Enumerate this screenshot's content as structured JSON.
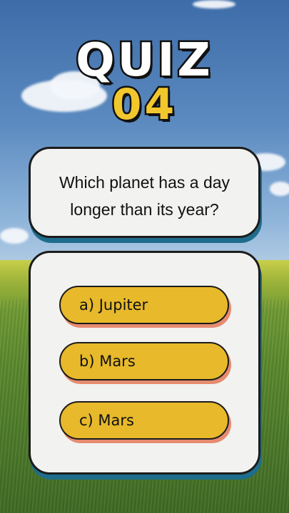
{
  "title": {
    "word": "QUIZ",
    "number": "04"
  },
  "question": {
    "text": "Which planet has a day\nlonger than its year?"
  },
  "answers": [
    {
      "label": "a) Jupiter"
    },
    {
      "label": "b) Mars"
    },
    {
      "label": "c) Mars"
    }
  ],
  "colors": {
    "answer_fill": "#e7b92b",
    "title_number": "#f2c72e",
    "card_fill": "#f2f2f0",
    "card_shadow": "#1f6d8c"
  }
}
